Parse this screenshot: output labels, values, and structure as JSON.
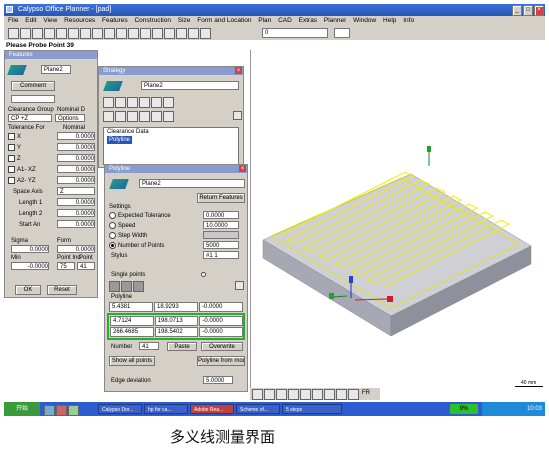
{
  "app": {
    "title": "Calypso Office Planner - [pad]",
    "window_buttons": [
      "_",
      "□",
      "×"
    ]
  },
  "menu": [
    "File",
    "Edit",
    "View",
    "Resources",
    "Features",
    "Construction",
    "Size",
    "Form and Location",
    "Plan",
    "CAD",
    "Extras",
    "Planner",
    "Window",
    "Help",
    "Info"
  ],
  "toolbar": {
    "dropdown1": "0",
    "dropdown2": ""
  },
  "status_prompt": "Please Probe Point 39",
  "features_panel": {
    "title": "Features",
    "plane_name": "Plane2",
    "comment_button": "Comment",
    "clearance_group_label": "Clearance Group",
    "nominal_label": "Nominal D",
    "cp_value": "CP +Z",
    "options_value": "Options",
    "tolerance_label": "Tolerance For",
    "nominal2_label": "Nominal",
    "rows": [
      {
        "label": "X",
        "value": "0.0000"
      },
      {
        "label": "Y",
        "value": "0.0000"
      },
      {
        "label": "Z",
        "value": "0.0000"
      },
      {
        "label": "A1- XZ",
        "value": "0.0000"
      },
      {
        "label": "A2- YZ",
        "value": "0.0000"
      }
    ],
    "space_axis_label": "Space Axis",
    "space_axis_value": "Z",
    "length1_label": "Length 1",
    "length1_value": "0.0000",
    "length2_label": "Length 2",
    "length2_value": "0.0000",
    "start_an_label": "Start An",
    "start_an_value": "0.0000",
    "sigma_label": "Sigma",
    "sigma_value": "0.0000",
    "form_label": "Form",
    "form_value": "0.0000",
    "min_label": "Min",
    "min_value": "-0.0000",
    "point_label": "Point Ind",
    "point_label2": "Point",
    "point_ind_value": "75",
    "point_value": "41",
    "ok_button": "OK",
    "reset_button": "Reset"
  },
  "strategy_panel": {
    "title": "Strategy",
    "plane_name": "Plane2",
    "list_items": [
      "Clearance Data",
      "Polyline"
    ]
  },
  "polyline_panel": {
    "title": "Polyline",
    "plane_name": "Plane2",
    "return_features_button": "Return Features",
    "settings_label": "Settings",
    "expected_tol_label": "Expected Tolerance",
    "expected_tol_value": "0.0000",
    "speed_label": "Speed",
    "speed_value": "10.0000",
    "step_width_label": "Step Width",
    "step_width_value": "",
    "num_points_label": "Number of Points",
    "num_points_value": "5000",
    "stylus_label": "Stylus",
    "stylus_value": "#1   1",
    "single_points_label": "Single points",
    "polyline_label": "Polyline",
    "points": [
      [
        "5.4381",
        "18.9293",
        "-0.0000"
      ],
      [
        "4.7124",
        "198.0713",
        "-0.0000"
      ],
      [
        "266.4685",
        "198.5402",
        "-0.0000"
      ]
    ],
    "number_label": "Number",
    "number_value": "41",
    "paste_button": "Paste",
    "overwrite_button": "Overwrite",
    "show_all_points_button": "Show all points",
    "polyline_from_model_button": "Polyline from model",
    "edge_deviation_label": "Edge deviation",
    "edge_deviation_value": "5.0000"
  },
  "viewport": {
    "scale_text": "40 mm",
    "bottom_toolbar_label": "FR"
  },
  "taskbar": {
    "start_label": "开始",
    "tasks": [
      "Calypso Dor...",
      "hp for ca...",
      "Adobe Rea...",
      "Scheme of...",
      "5 steps"
    ],
    "clock": "10:03",
    "tray_badge": "9%"
  },
  "caption": "多义线测量界面",
  "colors": {
    "title_blue": "#2a55b8",
    "viewport_bg": "#ffffff",
    "part_yellow": "#f0f000",
    "highlight_green": "#26b026"
  }
}
